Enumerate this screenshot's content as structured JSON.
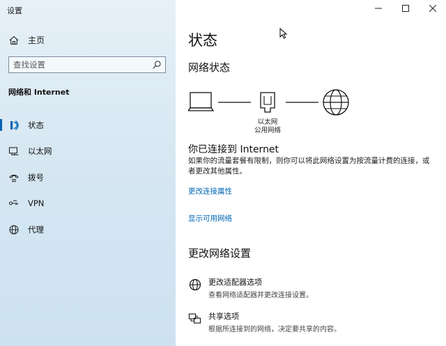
{
  "window": {
    "title": "设置"
  },
  "sidebar": {
    "home_label": "主页",
    "search_placeholder": "查找设置",
    "section_title": "网络和 Internet",
    "items": [
      {
        "label": "状态",
        "icon": "status-icon",
        "active": true
      },
      {
        "label": "以太网",
        "icon": "ethernet-icon",
        "active": false
      },
      {
        "label": "拨号",
        "icon": "dialup-icon",
        "active": false
      },
      {
        "label": "VPN",
        "icon": "vpn-icon",
        "active": false
      },
      {
        "label": "代理",
        "icon": "globe-icon",
        "active": false
      }
    ]
  },
  "main": {
    "title": "状态",
    "network_status_heading": "网络状态",
    "diagram": {
      "adapter_label": "以太网",
      "network_label": "公用网络"
    },
    "connected_text": "你已连接到 Internet",
    "description": "如果你的流量套餐有限制，则你可以将此网络设置为按流量计费的连接，或者更改其他属性。",
    "link_change_props": "更改连接属性",
    "link_show_networks": "显示可用网络",
    "change_settings_heading": "更改网络设置",
    "options": [
      {
        "title": "更改适配器选项",
        "desc": "查看网络适配器并更改连接设置。",
        "icon": "globe-icon"
      },
      {
        "title": "共享选项",
        "desc": "根据所连接到的网络，决定要共享的内容。",
        "icon": "sharing-icon"
      }
    ]
  },
  "colors": {
    "accent": "#0063b1",
    "link": "#0066b4",
    "sidebar_bg": "#d8e8f3"
  }
}
